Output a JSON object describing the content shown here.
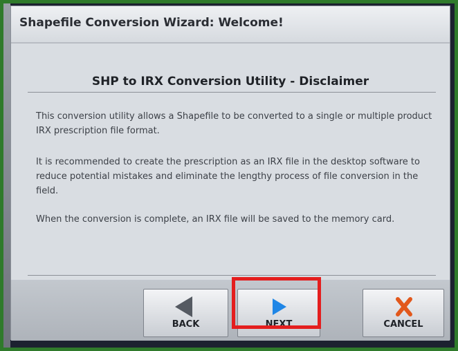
{
  "window": {
    "title": "Shapefile Conversion Wizard: Welcome!"
  },
  "content": {
    "heading": "SHP to IRX Conversion Utility - Disclaimer",
    "paragraphs": [
      "This conversion utility allows a Shapefile to be converted to a single or multiple product IRX prescription file format.",
      "It is recommended to create the prescription as an IRX file in the desktop software to reduce potential mistakes and eliminate the lengthy process of file conversion in the field.",
      "When the conversion is complete, an IRX file will be saved to the memory card."
    ]
  },
  "buttons": {
    "back": {
      "label": "BACK",
      "icon": "left-arrow-icon",
      "color": "#555a62"
    },
    "next": {
      "label": "NEXT",
      "icon": "right-arrow-icon",
      "color": "#1f86e6"
    },
    "cancel": {
      "label": "CANCEL",
      "icon": "x-icon",
      "color": "#e2581c"
    }
  },
  "highlight": {
    "target": "next-button",
    "color": "#e41e1e"
  }
}
